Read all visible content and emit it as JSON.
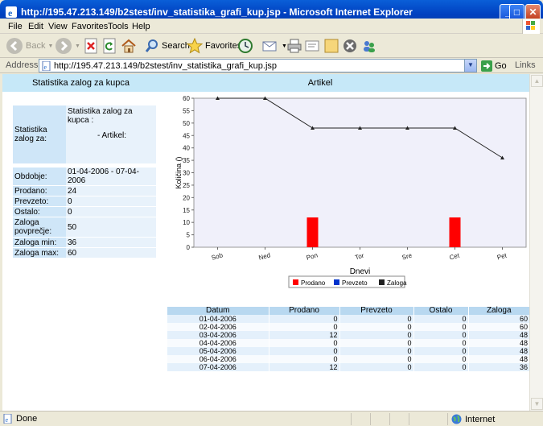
{
  "window": {
    "title": "http://195.47.213.149/b2stest/inv_statistika_grafi_kup.jsp - Microsoft Internet Explorer"
  },
  "menu": {
    "items": [
      "File",
      "Edit",
      "View",
      "Favorites",
      "Tools",
      "Help"
    ]
  },
  "toolbar": {
    "back_label": "Back",
    "search_label": "Search",
    "favorites_label": "Favorites"
  },
  "address": {
    "label": "Address",
    "url": "http://195.47.213.149/b2stest/inv_statistika_grafi_kup.jsp",
    "go_label": "Go",
    "links_label": "Links"
  },
  "page": {
    "header_left": "Statistika zalog za kupca",
    "header_right": "Artikel",
    "stats_label": "Statistika zalog za:",
    "stats_value_line1": "Statistika zalog za kupca :",
    "stats_value_line2": "- Artikel:",
    "rows": [
      {
        "key": "Obdobje:",
        "value": "01-04-2006 - 07-04-2006"
      },
      {
        "key": "Prodano:",
        "value": "24"
      },
      {
        "key": "Prevzeto:",
        "value": "0"
      },
      {
        "key": "Ostalo:",
        "value": "0"
      },
      {
        "key": "Zaloga povprečje:",
        "value": "50"
      },
      {
        "key": "Zaloga min:",
        "value": "36"
      },
      {
        "key": "Zaloga max:",
        "value": "60"
      }
    ]
  },
  "chart_data": {
    "type": "bar",
    "categories": [
      "Sob",
      "Ned",
      "Pon",
      "Tor",
      "Sre",
      "Cet",
      "Pet"
    ],
    "xlabel": "Dnevi",
    "ylabel": "Količina ()",
    "ylim": [
      0,
      60
    ],
    "yticks": [
      0,
      5,
      10,
      15,
      20,
      25,
      30,
      35,
      40,
      45,
      50,
      55,
      60
    ],
    "grid": false,
    "legend_position": "bottom",
    "series": [
      {
        "name": "Prodano",
        "type": "bar",
        "color": "#ff0000",
        "values": [
          0,
          0,
          12,
          0,
          0,
          12,
          0
        ]
      },
      {
        "name": "Prevzeto",
        "type": "bar",
        "color": "#0033cc",
        "values": [
          0,
          0,
          0,
          0,
          0,
          0,
          0
        ]
      },
      {
        "name": "Zaloga",
        "type": "line",
        "color": "#222222",
        "values": [
          60,
          60,
          48,
          48,
          48,
          48,
          36
        ]
      }
    ]
  },
  "table": {
    "headers": [
      "Datum",
      "Prodano",
      "Prevzeto",
      "Ostalo",
      "Zaloga"
    ],
    "rows": [
      [
        "01-04-2006",
        "0",
        "0",
        "0",
        "60"
      ],
      [
        "02-04-2006",
        "0",
        "0",
        "0",
        "60"
      ],
      [
        "03-04-2006",
        "12",
        "0",
        "0",
        "48"
      ],
      [
        "04-04-2006",
        "0",
        "0",
        "0",
        "48"
      ],
      [
        "05-04-2006",
        "0",
        "0",
        "0",
        "48"
      ],
      [
        "06-04-2006",
        "0",
        "0",
        "0",
        "48"
      ],
      [
        "07-04-2006",
        "12",
        "0",
        "0",
        "36"
      ]
    ]
  },
  "status": {
    "text": "Done",
    "zone": "Internet"
  }
}
